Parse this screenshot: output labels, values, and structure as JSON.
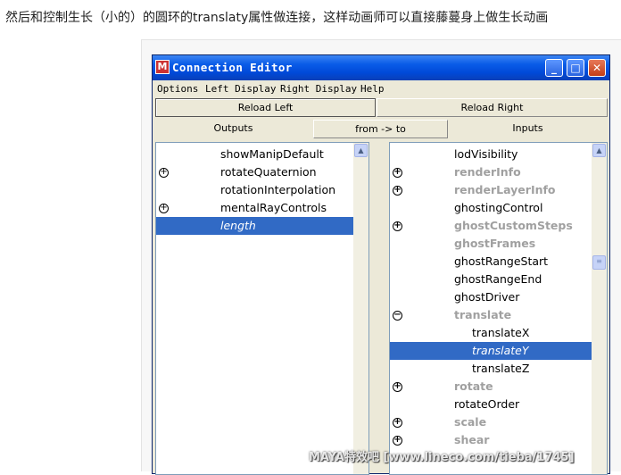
{
  "caption": "然后和控制生长（小的）的圆环的translaty属性做连接，这样动画师可以直接藤蔓身上做生长动画",
  "window": {
    "title": "Connection Editor",
    "app_icon": "maya-app-icon",
    "controls": [
      "minimize-icon",
      "maximize-icon",
      "close-icon"
    ]
  },
  "menu": [
    "Options",
    "Left Display",
    "Right Display",
    "Help"
  ],
  "reload_left": "Reload Left",
  "reload_right": "Reload Right",
  "header": {
    "outputs": "Outputs",
    "direction": "from -> to",
    "inputs": "Inputs"
  },
  "left_list": [
    {
      "label": "showManipDefault",
      "expander": "",
      "style": "normal"
    },
    {
      "label": "rotateQuaternion",
      "expander": "⊕",
      "style": "normal"
    },
    {
      "label": "rotationInterpolation",
      "expander": "",
      "style": "normal"
    },
    {
      "label": "mentalRayControls",
      "expander": "⊕",
      "style": "normal"
    },
    {
      "label": "length",
      "expander": "",
      "style": "selected"
    }
  ],
  "right_list": [
    {
      "label": "lodVisibility",
      "expander": "",
      "style": "normal",
      "indent": 0
    },
    {
      "label": "renderInfo",
      "expander": "⊕",
      "style": "grey",
      "indent": 0
    },
    {
      "label": "renderLayerInfo",
      "expander": "⊕",
      "style": "grey",
      "indent": 0
    },
    {
      "label": "ghostingControl",
      "expander": "",
      "style": "normal",
      "indent": 0
    },
    {
      "label": "ghostCustomSteps",
      "expander": "⊕",
      "style": "grey",
      "indent": 0
    },
    {
      "label": "ghostFrames",
      "expander": "",
      "style": "grey",
      "indent": 0
    },
    {
      "label": "ghostRangeStart",
      "expander": "",
      "style": "normal",
      "indent": 0
    },
    {
      "label": "ghostRangeEnd",
      "expander": "",
      "style": "normal",
      "indent": 0
    },
    {
      "label": "ghostDriver",
      "expander": "",
      "style": "normal",
      "indent": 0
    },
    {
      "label": "translate",
      "expander": "⊖",
      "style": "grey",
      "indent": 0
    },
    {
      "label": "translateX",
      "expander": "",
      "style": "normal",
      "indent": 1
    },
    {
      "label": "translateY",
      "expander": "",
      "style": "selected",
      "indent": 1
    },
    {
      "label": "translateZ",
      "expander": "",
      "style": "normal",
      "indent": 1
    },
    {
      "label": "rotate",
      "expander": "⊕",
      "style": "grey",
      "indent": 0
    },
    {
      "label": "rotateOrder",
      "expander": "",
      "style": "normal",
      "indent": 0
    },
    {
      "label": "scale",
      "expander": "⊕",
      "style": "grey",
      "indent": 0
    },
    {
      "label": "shear",
      "expander": "⊕",
      "style": "grey",
      "indent": 0
    }
  ],
  "watermark": "MAYA特效吧 [www.lineco.com/tieba/1745]",
  "colors": {
    "selection": "#316ac5",
    "grey_attr": "#a0a0a0",
    "titlebar": "#0a5ce8"
  }
}
